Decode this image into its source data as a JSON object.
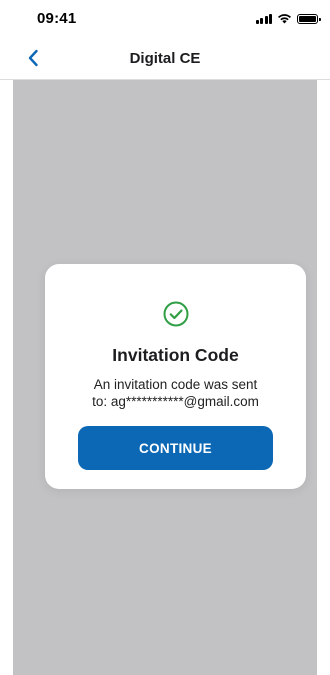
{
  "status_bar": {
    "time": "09:41"
  },
  "nav": {
    "title": "Digital CE",
    "back_icon": "chevron-left-icon"
  },
  "modal": {
    "icon": "check-circle-icon",
    "title": "Invitation Code",
    "message_line1": "An invitation code was sent",
    "message_line2": "to: ag***********@gmail.com",
    "continue_label": "CONTINUE"
  },
  "colors": {
    "accent": "#0c67b5",
    "success": "#2f9e44",
    "overlay": "#c2c2c4",
    "back_chevron": "#0c67b5"
  }
}
